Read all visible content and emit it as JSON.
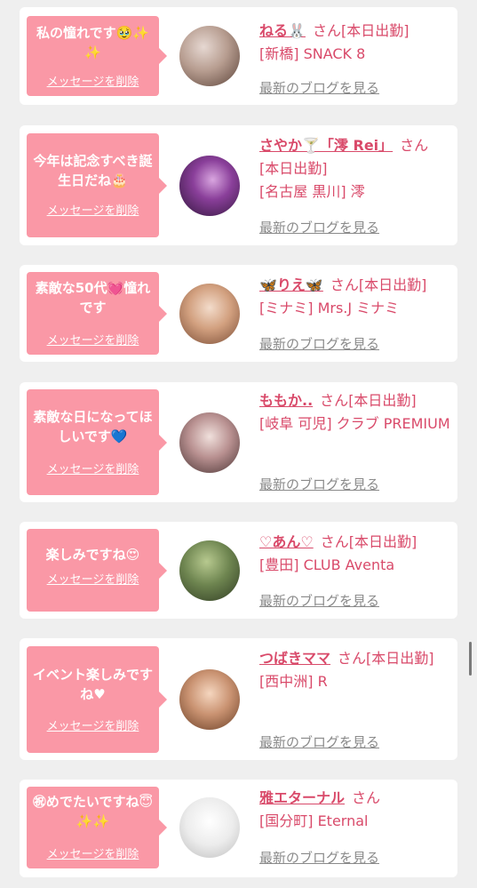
{
  "messages": [
    {
      "message": "私の憧れです🥹✨✨",
      "delete_label": "メッセージを削除",
      "name": "ねる🐰",
      "suffix": "さん",
      "status": "[本日出勤]",
      "store": "[新橋] SNACK 8",
      "blog_link": "最新のブログを見る",
      "avatar_colors": [
        "#d9c9c2",
        "#6e5548"
      ]
    },
    {
      "message": "今年は記念すべき誕生日だね🎂",
      "delete_label": "メッセージを削除",
      "name": "さやか🍸「澪 Rei」",
      "suffix": "さん",
      "status": "[本日出勤]",
      "store": "[名古屋 黒川] 澪",
      "blog_link": "最新のブログを見る",
      "avatar_colors": [
        "#5a2b6e",
        "#c78bd1"
      ]
    },
    {
      "message": "素敵な50代💓憧れです",
      "delete_label": "メッセージを削除",
      "name": "🦋りえ🦋",
      "suffix": "さん",
      "status": "[本日出勤]",
      "store": "[ミナミ] Mrs.J ミナミ",
      "blog_link": "最新のブログを見る",
      "avatar_colors": [
        "#f1d7c4",
        "#9b6a4f"
      ]
    },
    {
      "message": "素敵な日になってほしいです💙",
      "delete_label": "メッセージを削除",
      "name": "ももか..",
      "suffix": "さん",
      "status": "[本日出勤]",
      "store": "[岐阜 可児] クラブ PREMIUM",
      "blog_link": "最新のブログを見る",
      "avatar_colors": [
        "#e8d4d0",
        "#7d5b5b"
      ]
    },
    {
      "message": "楽しみですね😍",
      "delete_label": "メッセージを削除",
      "name": "♡あん♡",
      "suffix": "さん",
      "status": "[本日出勤]",
      "store": "[豊田] CLUB Aventa",
      "blog_link": "最新のブログを見る",
      "avatar_colors": [
        "#8da36a",
        "#4d5f3a"
      ]
    },
    {
      "message": "イベント楽しみですね♥",
      "delete_label": "メッセージを削除",
      "name": "つばきママ",
      "suffix": "さん",
      "status": "[本日出勤]",
      "store": "[西中洲] R",
      "blog_link": "最新のブログを見る",
      "avatar_colors": [
        "#e9c6a8",
        "#8c5a3a"
      ]
    },
    {
      "message": "㊗めでたいですね😇✨✨",
      "delete_label": "メッセージを削除",
      "name": "雅エターナル",
      "suffix": "さん",
      "status": "",
      "store": "[国分町] Eternal",
      "blog_link": "最新のブログを見る",
      "avatar_colors": [
        "#f4f4f4",
        "#cfcfcf"
      ]
    }
  ],
  "theme": {
    "accent": "#d94a6a",
    "bubble": "#fa98a6",
    "page_bg": "#efefef",
    "link_gray": "#8a8a8a"
  }
}
